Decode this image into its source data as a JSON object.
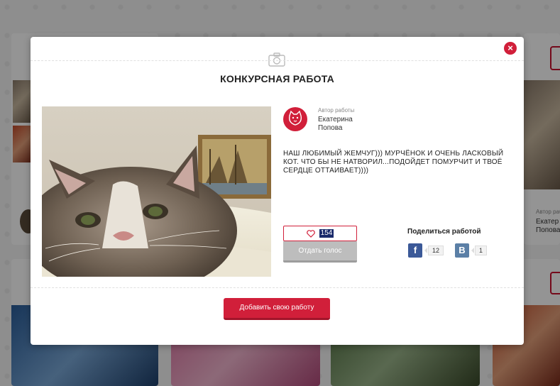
{
  "modal": {
    "title": "КОНКУРСНАЯ РАБОТА",
    "close_symbol": "×",
    "author": {
      "caption": "Автор работы",
      "name": "Екатерина Попова"
    },
    "description": "НАШ ЛЮБИМЫЙ ЖЕМЧУГ))) МУРЧЁНОК И ОЧЕНЬ ЛАСКОВЫЙ КОТ. ЧТО БЫ НЕ НАТВОРИЛ...ПОДОЙДЕТ ПОМУРЧИТ И ТВОЁ СЕРДЦЕ ОТТАИВАЕТ))))",
    "likes": "154",
    "vote_label": "Отдать голос",
    "share": {
      "label": "Поделиться работой",
      "facebook": {
        "letter": "f",
        "count": "12"
      },
      "vkontakte": {
        "letter": "В",
        "count": "1"
      }
    },
    "add_button_label": "Добавить свою работу"
  },
  "background": {
    "author_caption": "Автор работ",
    "author_name_line1": "Екатер",
    "author_name_line2": "Попова"
  },
  "colors": {
    "accent": "#d11f3a",
    "facebook": "#3b5998",
    "vkontakte": "#5b7fa6"
  }
}
